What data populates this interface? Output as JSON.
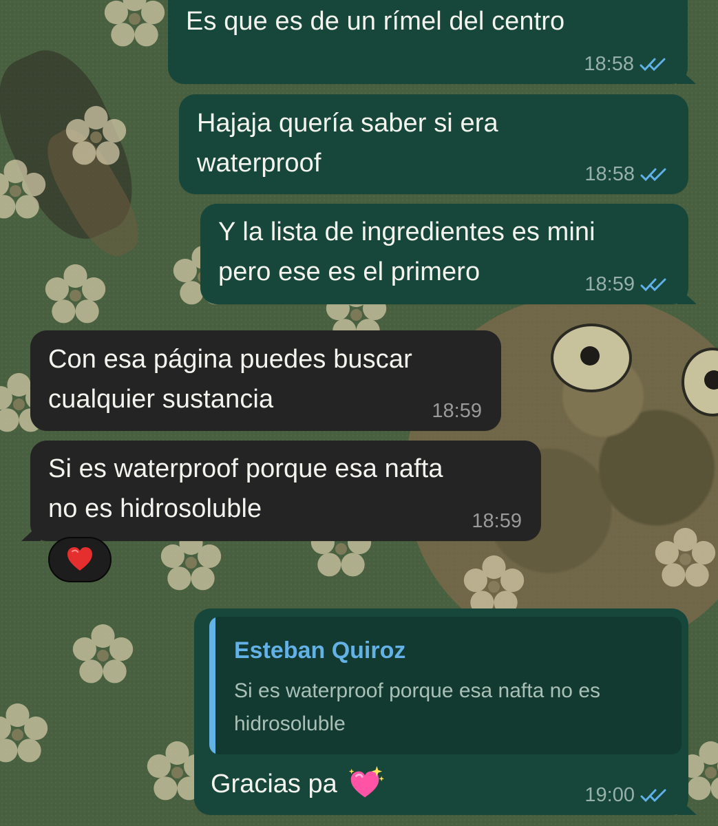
{
  "messages": [
    {
      "direction": "outgoing",
      "lines": [
        "Es que es de un rímel del centro"
      ],
      "time": "18:58",
      "status_icon": "double-check-icon"
    },
    {
      "direction": "outgoing",
      "lines": [
        "Hajaja quería saber si era",
        "waterproof"
      ],
      "time": "18:58",
      "status_icon": "double-check-icon"
    },
    {
      "direction": "outgoing",
      "lines": [
        "Y la lista de ingredientes es mini",
        "pero ese es el primero"
      ],
      "time": "18:59",
      "status_icon": "double-check-icon"
    },
    {
      "direction": "incoming",
      "lines": [
        "Con esa página puedes buscar",
        "cualquier sustancia"
      ],
      "time": "18:59"
    },
    {
      "direction": "incoming",
      "lines": [
        "Si es waterproof porque esa nafta",
        "no es hidrosoluble"
      ],
      "time": "18:59",
      "reaction": "red-heart-icon"
    },
    {
      "direction": "outgoing",
      "reply": {
        "author": "Esteban Quiroz",
        "lines": [
          "Si es waterproof porque esa nafta no es",
          "hidrosoluble"
        ]
      },
      "lines": [
        "Gracias pa"
      ],
      "emoji": "sparkling-heart-icon",
      "time": "19:00",
      "status_icon": "double-check-icon"
    }
  ],
  "colors": {
    "outgoing_bubble": "#17473b",
    "incoming_bubble": "#242424",
    "reply_accent": "#64b3e6",
    "timestamp": "#98b1a8",
    "read_ticks": "#5fb1e8",
    "wallpaper": "#48603f"
  }
}
